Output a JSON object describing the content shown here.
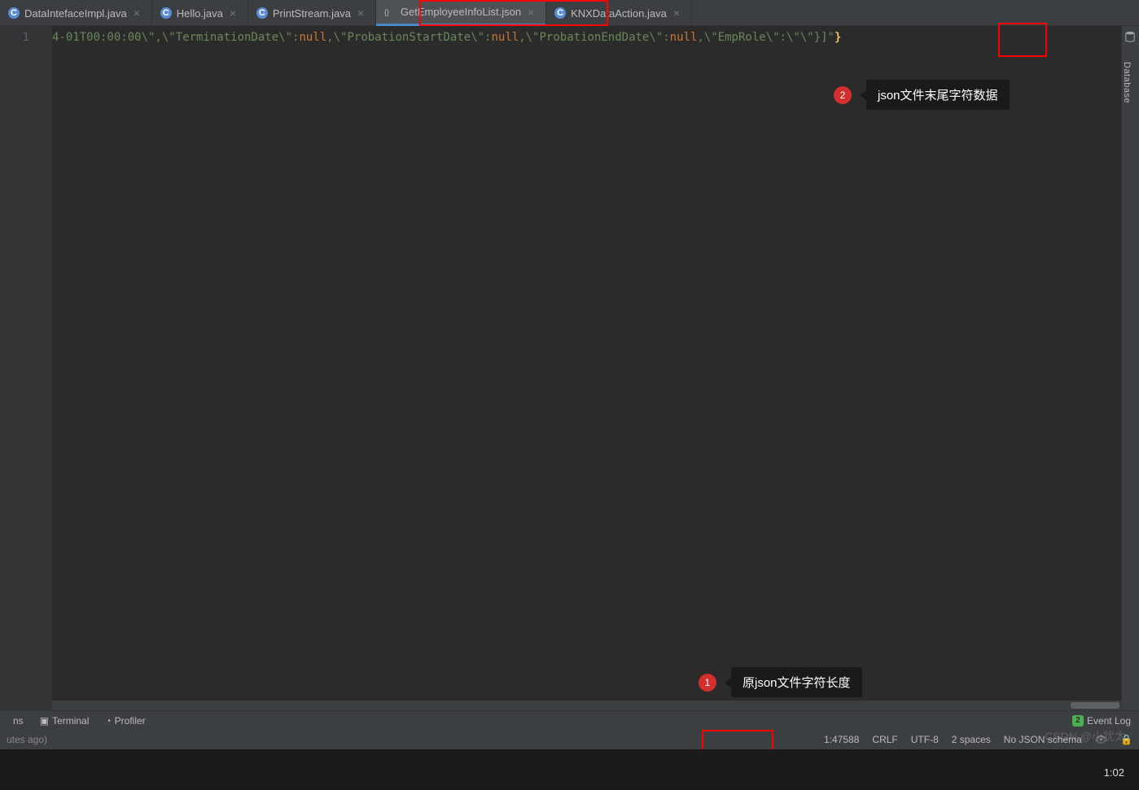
{
  "tabs": [
    {
      "label": "DataIntefaceImpl.java",
      "type": "java"
    },
    {
      "label": "Hello.java",
      "type": "java"
    },
    {
      "label": "PrintStream.java",
      "type": "java"
    },
    {
      "label": "GetEmployeeInfoList.json",
      "type": "json",
      "active": true
    },
    {
      "label": "KNXDataAction.java",
      "type": "java"
    }
  ],
  "gutter": {
    "line1": "1"
  },
  "code": {
    "frag_date": "4-01T00:00:00\\\",\\\"",
    "frag_term": "TerminationDate",
    "frag_sep1": "\\\":",
    "frag_null1": "null",
    "frag_comma1": ",\\\"",
    "frag_prob_start": "ProbationStartDate",
    "frag_sep2": "\\\":",
    "frag_null2": "null",
    "frag_comma2": ",\\\"",
    "frag_prob_end": "ProbationEndDate",
    "frag_sep3": "\\\":",
    "frag_null3": "null",
    "frag_comma3": ",\\\"",
    "frag_emprole": "EmpRole",
    "frag_tail": "\\\":\\\"\\\"}]\"",
    "frag_close": "}"
  },
  "sidepanel": {
    "label": "Database"
  },
  "callouts": {
    "c1": {
      "num": "1",
      "text": "原json文件字符长度"
    },
    "c2": {
      "num": "2",
      "text": "json文件末尾字符数据"
    }
  },
  "tools": {
    "terminal_prefix": "ns",
    "terminal": "Terminal",
    "profiler": "Profiler",
    "event_count": "2",
    "event_log": "Event Log"
  },
  "status": {
    "left": "utes ago)",
    "position": "1:47588",
    "line_sep": "CRLF",
    "encoding": "UTF-8",
    "indent": "2 spaces",
    "schema": "No JSON schema"
  },
  "watermark": "CSDN @小犹太",
  "clock": "1:02"
}
